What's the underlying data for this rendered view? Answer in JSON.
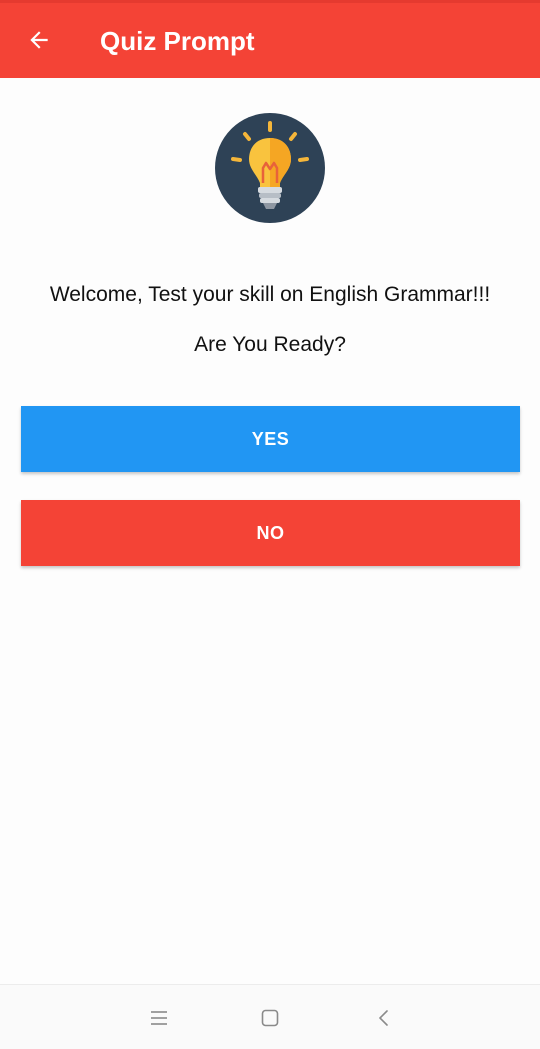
{
  "appbar": {
    "title": "Quiz Prompt",
    "back_icon": "arrow-left-icon",
    "color": "#f44336"
  },
  "content": {
    "logo_icon": "lightbulb-icon",
    "welcome_text": "Welcome, Test your skill on English Grammar!!!",
    "ready_text": "Are You Ready?"
  },
  "buttons": {
    "yes_label": "YES",
    "yes_color": "#2196f3",
    "no_label": "NO",
    "no_color": "#f44336"
  },
  "system_nav": {
    "menu_icon": "menu-icon",
    "home_icon": "home-square-icon",
    "back_icon": "chevron-left-icon"
  }
}
